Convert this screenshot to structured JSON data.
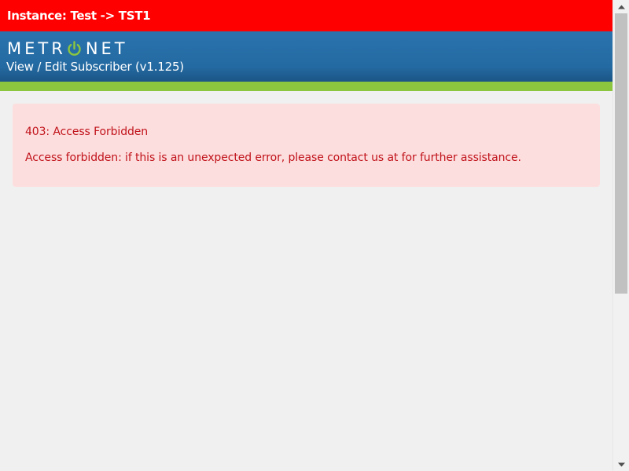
{
  "instance_bar": {
    "text": "Instance: Test -> TST1",
    "color": "#ff0000"
  },
  "header": {
    "logo": {
      "text_before": "METR",
      "text_after": "NET",
      "icon": "power-icon",
      "icon_color": "#8cc63f"
    },
    "page_title": "View / Edit Subscriber (v1.125)",
    "color": "#2569a3"
  },
  "accent_bar_color": "#8cc63f",
  "alert": {
    "title": "403: Access Forbidden",
    "message": "Access forbidden: if this is an unexpected error, please contact us at for further assistance.",
    "background": "#fddede",
    "text_color": "#c0121a"
  },
  "scrollbar": {
    "up_icon": "arrow-up-icon",
    "down_icon": "arrow-down-icon"
  }
}
